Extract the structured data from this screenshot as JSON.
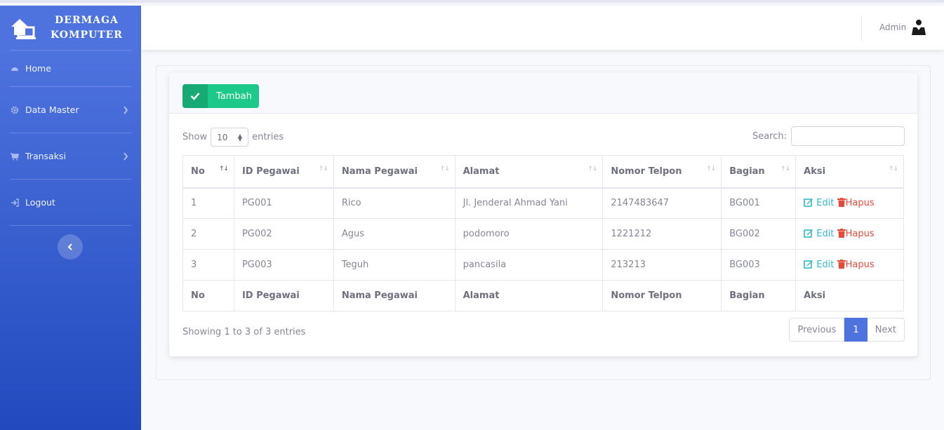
{
  "brand": {
    "line1": "DERMAGA",
    "line2": "KOMPUTER"
  },
  "sidebar": {
    "items": [
      {
        "label": "Home",
        "icon": "dashboard-icon"
      },
      {
        "label": "Data Master",
        "icon": "gear-icon",
        "has_submenu": true
      },
      {
        "label": "Transaksi",
        "icon": "cart-icon",
        "has_submenu": true
      },
      {
        "label": "Logout",
        "icon": "logout-icon"
      }
    ]
  },
  "topbar": {
    "user_name": "Admin",
    "user_icon": "user-avatar-icon"
  },
  "toolbar": {
    "add_label": "Tambah",
    "add_icon": "check-icon"
  },
  "table_controls": {
    "show_label": "Show",
    "entries_value": "10",
    "entries_label": "entries",
    "search_label": "Search:",
    "search_value": ""
  },
  "table": {
    "headers": [
      "No",
      "ID Pegawai",
      "Nama Pegawai",
      "Alamat",
      "Nomor Telpon",
      "Bagian",
      "Aksi"
    ],
    "rows": [
      [
        "1",
        "PG001",
        "Rico",
        "Jl. Jenderal Ahmad Yani",
        "2147483647",
        "BG001"
      ],
      [
        "2",
        "PG002",
        "Agus",
        "podomoro",
        "1221212",
        "BG002"
      ],
      [
        "3",
        "PG003",
        "Teguh",
        "pancasila",
        "213213",
        "BG003"
      ]
    ],
    "edit_label": "Edit",
    "delete_label": "Hapus"
  },
  "footer": {
    "info": "Showing 1 to 3 of 3 entries",
    "prev_label": "Previous",
    "current_page": "1",
    "next_label": "Next"
  },
  "colors": {
    "sidebar_top": "#4e73df",
    "sidebar_bottom": "#224abe",
    "success": "#1cc88a",
    "info": "#36b9cc",
    "danger": "#e74a3b",
    "primary": "#4e73df"
  }
}
